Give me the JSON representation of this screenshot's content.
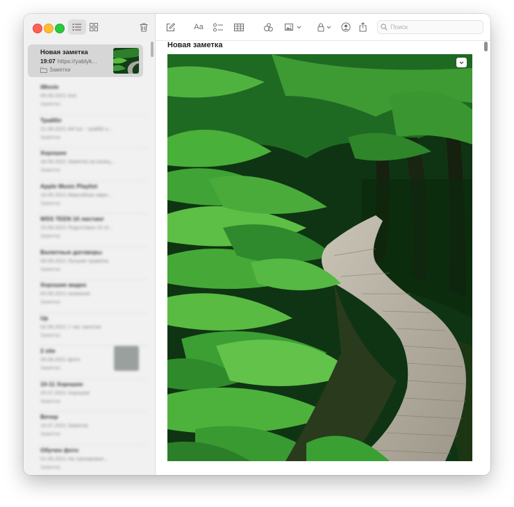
{
  "toolbar": {
    "search_placeholder": "Поиск",
    "format_label": "Aa"
  },
  "selected_note": {
    "title": "Новая заметка",
    "time": "19:07",
    "preview": "https://yablyk...",
    "folder": "Заметки"
  },
  "blurred_notes": [
    {
      "title": "iMovie",
      "date": "09.09.2021",
      "preview": "test",
      "folder": "Заметки"
    },
    {
      "title": "Трайбл",
      "date": "21.09.2021",
      "preview": "AR lux - трайбл к...",
      "folder": "Заметки"
    },
    {
      "title": "Хорошее",
      "date": "18.09.2021",
      "preview": "Заметка на конец...",
      "folder": "Заметки"
    },
    {
      "title": "Apple Music Playlist",
      "date": "16.09.2021",
      "preview": "Мирсайхан аври...",
      "folder": "Заметки"
    },
    {
      "title": "WSS TEEN 10 листинг",
      "date": "15.09.2021",
      "preview": "Подготовка 10 от...",
      "folder": "Заметки"
    },
    {
      "title": "Валютные договоры",
      "date": "09.09.2021",
      "preview": "Лучшие правила",
      "folder": "Заметки"
    },
    {
      "title": "Хорошие видео",
      "date": "03.09.2021",
      "preview": "название",
      "folder": "Заметки"
    },
    {
      "title": "Up",
      "date": "02.09.2021",
      "preview": "1 час занятия",
      "folder": "Заметки"
    },
    {
      "title": "2 site",
      "date": "28.08.2021",
      "preview": "фото",
      "folder": "Заметки"
    },
    {
      "title": "10-11 Хорошее",
      "date": "25.07.2021",
      "preview": "Хорошее",
      "folder": "Заметки"
    },
    {
      "title": "Вечер",
      "date": "19.07.2021",
      "preview": "Заметка",
      "folder": "Заметки"
    },
    {
      "title": "Обучен фото",
      "date": "01.06.2021",
      "preview": "На тренировке...",
      "folder": "Заметки"
    }
  ],
  "colors": {
    "sidebar_bg": "#f1f1f1",
    "selection_bg": "#d6d6d6",
    "traffic_red": "#fe5f57",
    "traffic_yellow": "#febc2e",
    "traffic_green": "#28c840"
  },
  "icons": {
    "list_view": "list-icon",
    "gallery_view": "grid-icon",
    "trash": "trash-icon",
    "compose": "compose-icon",
    "checklist": "checklist-icon",
    "table": "table-icon",
    "collaborate": "collaborate-icon",
    "media": "photo-icon",
    "lock": "lock-icon",
    "share": "share-icon",
    "search": "search-icon"
  }
}
